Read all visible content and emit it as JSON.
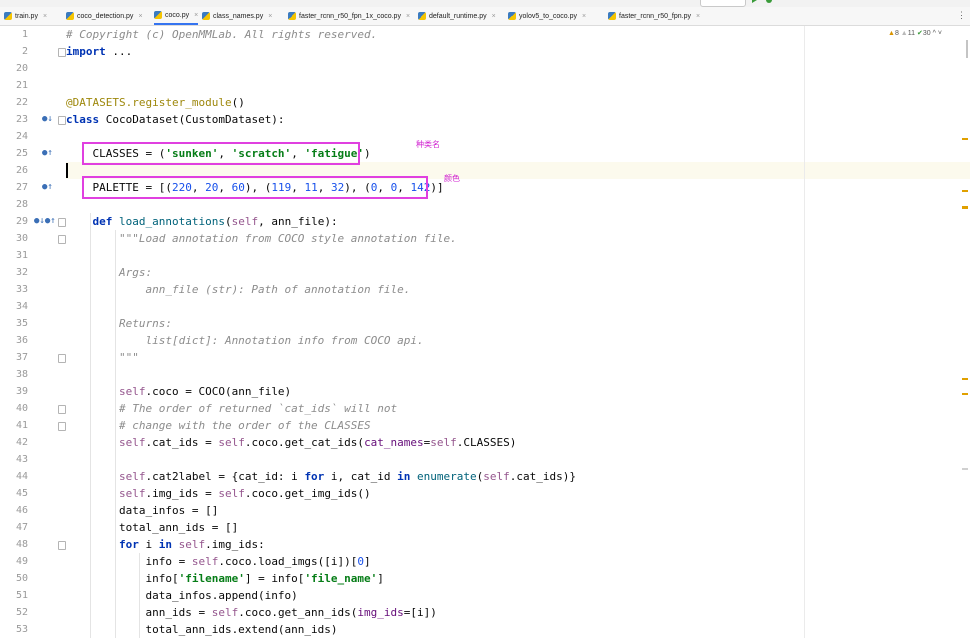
{
  "tabs": [
    {
      "label": "train.py",
      "active": false
    },
    {
      "label": "coco_detection.py",
      "active": false
    },
    {
      "label": "coco.py",
      "active": true
    },
    {
      "label": "class_names.py",
      "active": false
    },
    {
      "label": "faster_rcnn_r50_fpn_1x_coco.py",
      "active": false
    },
    {
      "label": "default_runtime.py",
      "active": false
    },
    {
      "label": "yolov5_to_coco.py",
      "active": false
    },
    {
      "label": "faster_rcnn_r50_fpn.py",
      "active": false
    }
  ],
  "tab_close_glyph": "×",
  "tabs_overflow_glyph": "⋮",
  "inspections": {
    "warnings": "8",
    "weak_warnings": "11",
    "typos": "30",
    "nav": "^ ˅"
  },
  "annotations": {
    "classes_note": "种类名",
    "palette_note": "颜色"
  },
  "colors": {
    "highlight": "#e040e0",
    "keyword": "#0033b3",
    "string": "#067d17",
    "number": "#1750eb",
    "comment": "#8c8c8c"
  },
  "editor": {
    "lines": [
      {
        "n": "1",
        "tokens": [
          {
            "c": "cmt",
            "t": "# Copyright (c) OpenMMLab. All rights reserved."
          }
        ]
      },
      {
        "n": "2",
        "tokens": [
          {
            "c": "kw",
            "t": "import"
          },
          {
            "c": "",
            "t": " ..."
          }
        ]
      },
      {
        "n": "20",
        "tokens": []
      },
      {
        "n": "21",
        "tokens": []
      },
      {
        "n": "22",
        "tokens": [
          {
            "c": "deco",
            "t": "@DATASETS.register_module"
          },
          {
            "c": "",
            "t": "()"
          }
        ]
      },
      {
        "n": "23",
        "tokens": [
          {
            "c": "kw",
            "t": "class"
          },
          {
            "c": "",
            "t": " CocoDataset(CustomDataset):"
          }
        ]
      },
      {
        "n": "24",
        "tokens": []
      },
      {
        "n": "25",
        "tokens": [
          {
            "c": "",
            "t": "    CLASSES = ("
          },
          {
            "c": "str",
            "t": "'sunken'"
          },
          {
            "c": "",
            "t": ", "
          },
          {
            "c": "str",
            "t": "'scratch'"
          },
          {
            "c": "",
            "t": ", "
          },
          {
            "c": "str",
            "t": "'fatigue'"
          },
          {
            "c": "",
            "t": ")"
          }
        ]
      },
      {
        "n": "26",
        "tokens": []
      },
      {
        "n": "27",
        "tokens": [
          {
            "c": "",
            "t": "    PALETTE = [("
          },
          {
            "c": "num",
            "t": "220"
          },
          {
            "c": "",
            "t": ", "
          },
          {
            "c": "num",
            "t": "20"
          },
          {
            "c": "",
            "t": ", "
          },
          {
            "c": "num",
            "t": "60"
          },
          {
            "c": "",
            "t": "), ("
          },
          {
            "c": "num",
            "t": "119"
          },
          {
            "c": "",
            "t": ", "
          },
          {
            "c": "num",
            "t": "11"
          },
          {
            "c": "",
            "t": ", "
          },
          {
            "c": "num",
            "t": "32"
          },
          {
            "c": "",
            "t": "), ("
          },
          {
            "c": "num",
            "t": "0"
          },
          {
            "c": "",
            "t": ", "
          },
          {
            "c": "num",
            "t": "0"
          },
          {
            "c": "",
            "t": ", "
          },
          {
            "c": "num",
            "t": "142"
          },
          {
            "c": "",
            "t": ")]"
          }
        ]
      },
      {
        "n": "28",
        "tokens": []
      },
      {
        "n": "29",
        "tokens": [
          {
            "c": "",
            "t": "    "
          },
          {
            "c": "kw",
            "t": "def"
          },
          {
            "c": "",
            "t": " "
          },
          {
            "c": "call",
            "t": "load_annotations"
          },
          {
            "c": "",
            "t": "("
          },
          {
            "c": "selfk",
            "t": "self"
          },
          {
            "c": "",
            "t": ", ann_file):"
          }
        ]
      },
      {
        "n": "30",
        "tokens": [
          {
            "c": "cmt",
            "t": "        \"\"\"Load annotation from COCO style annotation file."
          }
        ]
      },
      {
        "n": "31",
        "tokens": []
      },
      {
        "n": "32",
        "tokens": [
          {
            "c": "cmt",
            "t": "        Args:"
          }
        ]
      },
      {
        "n": "33",
        "tokens": [
          {
            "c": "cmt",
            "t": "            ann_file (str): Path of annotation file."
          }
        ]
      },
      {
        "n": "34",
        "tokens": []
      },
      {
        "n": "35",
        "tokens": [
          {
            "c": "cmt",
            "t": "        Returns:"
          }
        ]
      },
      {
        "n": "36",
        "tokens": [
          {
            "c": "cmt",
            "t": "            list[dict]: Annotation info from COCO api."
          }
        ]
      },
      {
        "n": "37",
        "tokens": [
          {
            "c": "cmt",
            "t": "        \"\"\""
          }
        ]
      },
      {
        "n": "38",
        "tokens": []
      },
      {
        "n": "39",
        "tokens": [
          {
            "c": "",
            "t": "        "
          },
          {
            "c": "selfk",
            "t": "self"
          },
          {
            "c": "",
            "t": ".coco = COCO(ann_file)"
          }
        ]
      },
      {
        "n": "40",
        "tokens": [
          {
            "c": "cmt",
            "t": "        # The order of returned `cat_ids` will not"
          }
        ]
      },
      {
        "n": "41",
        "tokens": [
          {
            "c": "cmt",
            "t": "        # change with the order of the CLASSES"
          }
        ]
      },
      {
        "n": "42",
        "tokens": [
          {
            "c": "",
            "t": "        "
          },
          {
            "c": "selfk",
            "t": "self"
          },
          {
            "c": "",
            "t": ".cat_ids = "
          },
          {
            "c": "selfk",
            "t": "self"
          },
          {
            "c": "",
            "t": ".coco.get_cat_ids("
          },
          {
            "c": "param",
            "t": "cat_names"
          },
          {
            "c": "",
            "t": "="
          },
          {
            "c": "selfk",
            "t": "self"
          },
          {
            "c": "",
            "t": ".CLASSES)"
          }
        ]
      },
      {
        "n": "43",
        "tokens": []
      },
      {
        "n": "44",
        "tokens": [
          {
            "c": "",
            "t": "        "
          },
          {
            "c": "selfk",
            "t": "self"
          },
          {
            "c": "",
            "t": ".cat2label = {cat_id: i "
          },
          {
            "c": "kw",
            "t": "for"
          },
          {
            "c": "",
            "t": " i, cat_id "
          },
          {
            "c": "kw",
            "t": "in"
          },
          {
            "c": "",
            "t": " "
          },
          {
            "c": "call",
            "t": "enumerate"
          },
          {
            "c": "",
            "t": "("
          },
          {
            "c": "selfk",
            "t": "self"
          },
          {
            "c": "",
            "t": ".cat_ids)}"
          }
        ]
      },
      {
        "n": "45",
        "tokens": [
          {
            "c": "",
            "t": "        "
          },
          {
            "c": "selfk",
            "t": "self"
          },
          {
            "c": "",
            "t": ".img_ids = "
          },
          {
            "c": "selfk",
            "t": "self"
          },
          {
            "c": "",
            "t": ".coco.get_img_ids()"
          }
        ]
      },
      {
        "n": "46",
        "tokens": [
          {
            "c": "",
            "t": "        data_infos = []"
          }
        ]
      },
      {
        "n": "47",
        "tokens": [
          {
            "c": "",
            "t": "        total_ann_ids = []"
          }
        ]
      },
      {
        "n": "48",
        "tokens": [
          {
            "c": "",
            "t": "        "
          },
          {
            "c": "kw",
            "t": "for"
          },
          {
            "c": "",
            "t": " i "
          },
          {
            "c": "kw",
            "t": "in"
          },
          {
            "c": "",
            "t": " "
          },
          {
            "c": "selfk",
            "t": "self"
          },
          {
            "c": "",
            "t": ".img_ids:"
          }
        ]
      },
      {
        "n": "49",
        "tokens": [
          {
            "c": "",
            "t": "            info = "
          },
          {
            "c": "selfk",
            "t": "self"
          },
          {
            "c": "",
            "t": ".coco.load_imgs([i])["
          },
          {
            "c": "num",
            "t": "0"
          },
          {
            "c": "",
            "t": "]"
          }
        ]
      },
      {
        "n": "50",
        "tokens": [
          {
            "c": "",
            "t": "            info["
          },
          {
            "c": "str",
            "t": "'filename'"
          },
          {
            "c": "",
            "t": "] = info["
          },
          {
            "c": "str",
            "t": "'file_name'"
          },
          {
            "c": "",
            "t": "]"
          }
        ]
      },
      {
        "n": "51",
        "tokens": [
          {
            "c": "",
            "t": "            data_infos.append(info)"
          }
        ]
      },
      {
        "n": "52",
        "tokens": [
          {
            "c": "",
            "t": "            ann_ids = "
          },
          {
            "c": "selfk",
            "t": "self"
          },
          {
            "c": "",
            "t": ".coco.get_ann_ids("
          },
          {
            "c": "param",
            "t": "img_ids"
          },
          {
            "c": "",
            "t": "=[i])"
          }
        ]
      },
      {
        "n": "53",
        "tokens": [
          {
            "c": "",
            "t": "            total_ann_ids.extend(ann_ids)"
          }
        ]
      }
    ]
  }
}
